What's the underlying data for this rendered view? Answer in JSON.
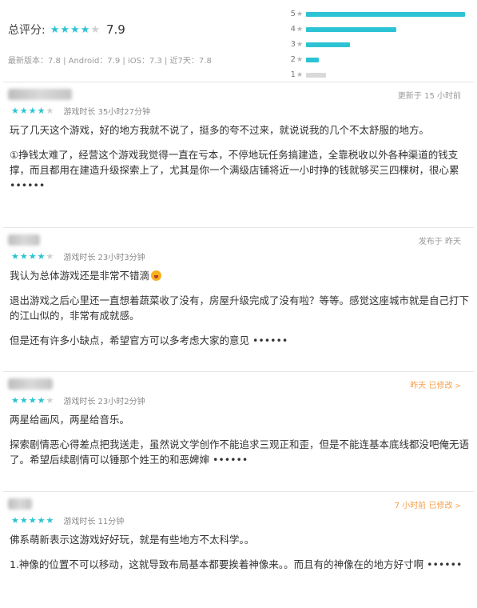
{
  "summary": {
    "score_label": "总评分:",
    "score_value": "7.9",
    "score_stars": 4,
    "versions": "最新版本：7.8  |  Android：7.9  |  iOS：7.3  |  近7天：7.8",
    "distribution": [
      {
        "stars": "5",
        "fraction": 0.97
      },
      {
        "stars": "4",
        "fraction": 0.55
      },
      {
        "stars": "3",
        "fraction": 0.27
      },
      {
        "stars": "2",
        "fraction": 0.08
      },
      {
        "stars": "1",
        "fraction": 0.12
      }
    ],
    "colors": {
      "accent": "#2cc3d4",
      "low": "#d9d9d9"
    }
  },
  "reviews": [
    {
      "meta": "更新于 15 小时前",
      "stars": 4,
      "playtime": "游戏时长 35小时27分钟",
      "paragraphs": [
        "玩了几天这个游戏，好的地方我就不说了，挺多的夸不过来，就说说我的几个不太舒服的地方。",
        "①挣钱太难了，经营这个游戏我觉得一直在亏本，不停地玩任务搞建造，全靠税收以外各种渠道的钱支撑，而且都用在建造升级探索上了，尤其是你一个满级店铺将近一小时挣的钱就够买三四棵树，很心累 ••••••"
      ]
    },
    {
      "meta": "发布于 昨天",
      "stars": 4,
      "playtime": "游戏时长 23小时3分钟",
      "paragraphs": [
        "我认为总体游戏还是非常不错滴",
        "退出游戏之后心里还一直想着蔬菜收了没有，房屋升级完成了没有啦？等等。感觉这座城市就是自己打下的江山似的，非常有成就感。",
        "但是还有许多小缺点，希望官方可以多考虑大家的意见 ••••••"
      ]
    },
    {
      "meta": "昨天 已修改",
      "stars": 4,
      "playtime": "游戏时长 23小时2分钟",
      "paragraphs": [
        "两星给画风，两星给音乐。",
        "探索剧情恶心得差点把我送走，虽然说文学创作不能追求三观正和歪，但是不能连基本底线都没吧俺无语了。希望后续剧情可以锤那个姓王的和恶婢婶 ••••••"
      ]
    },
    {
      "meta": "7 小时前 已修改",
      "stars": 5,
      "playtime": "游戏时长 11分钟",
      "paragraphs": [
        "佛系萌新表示这游戏好好玩，就是有些地方不太科学。。",
        "1.神像的位置不可以移动，这就导致布局基本都要挨着神像来。。而且有的神像在的地方好寸啊 ••••••"
      ]
    }
  ]
}
